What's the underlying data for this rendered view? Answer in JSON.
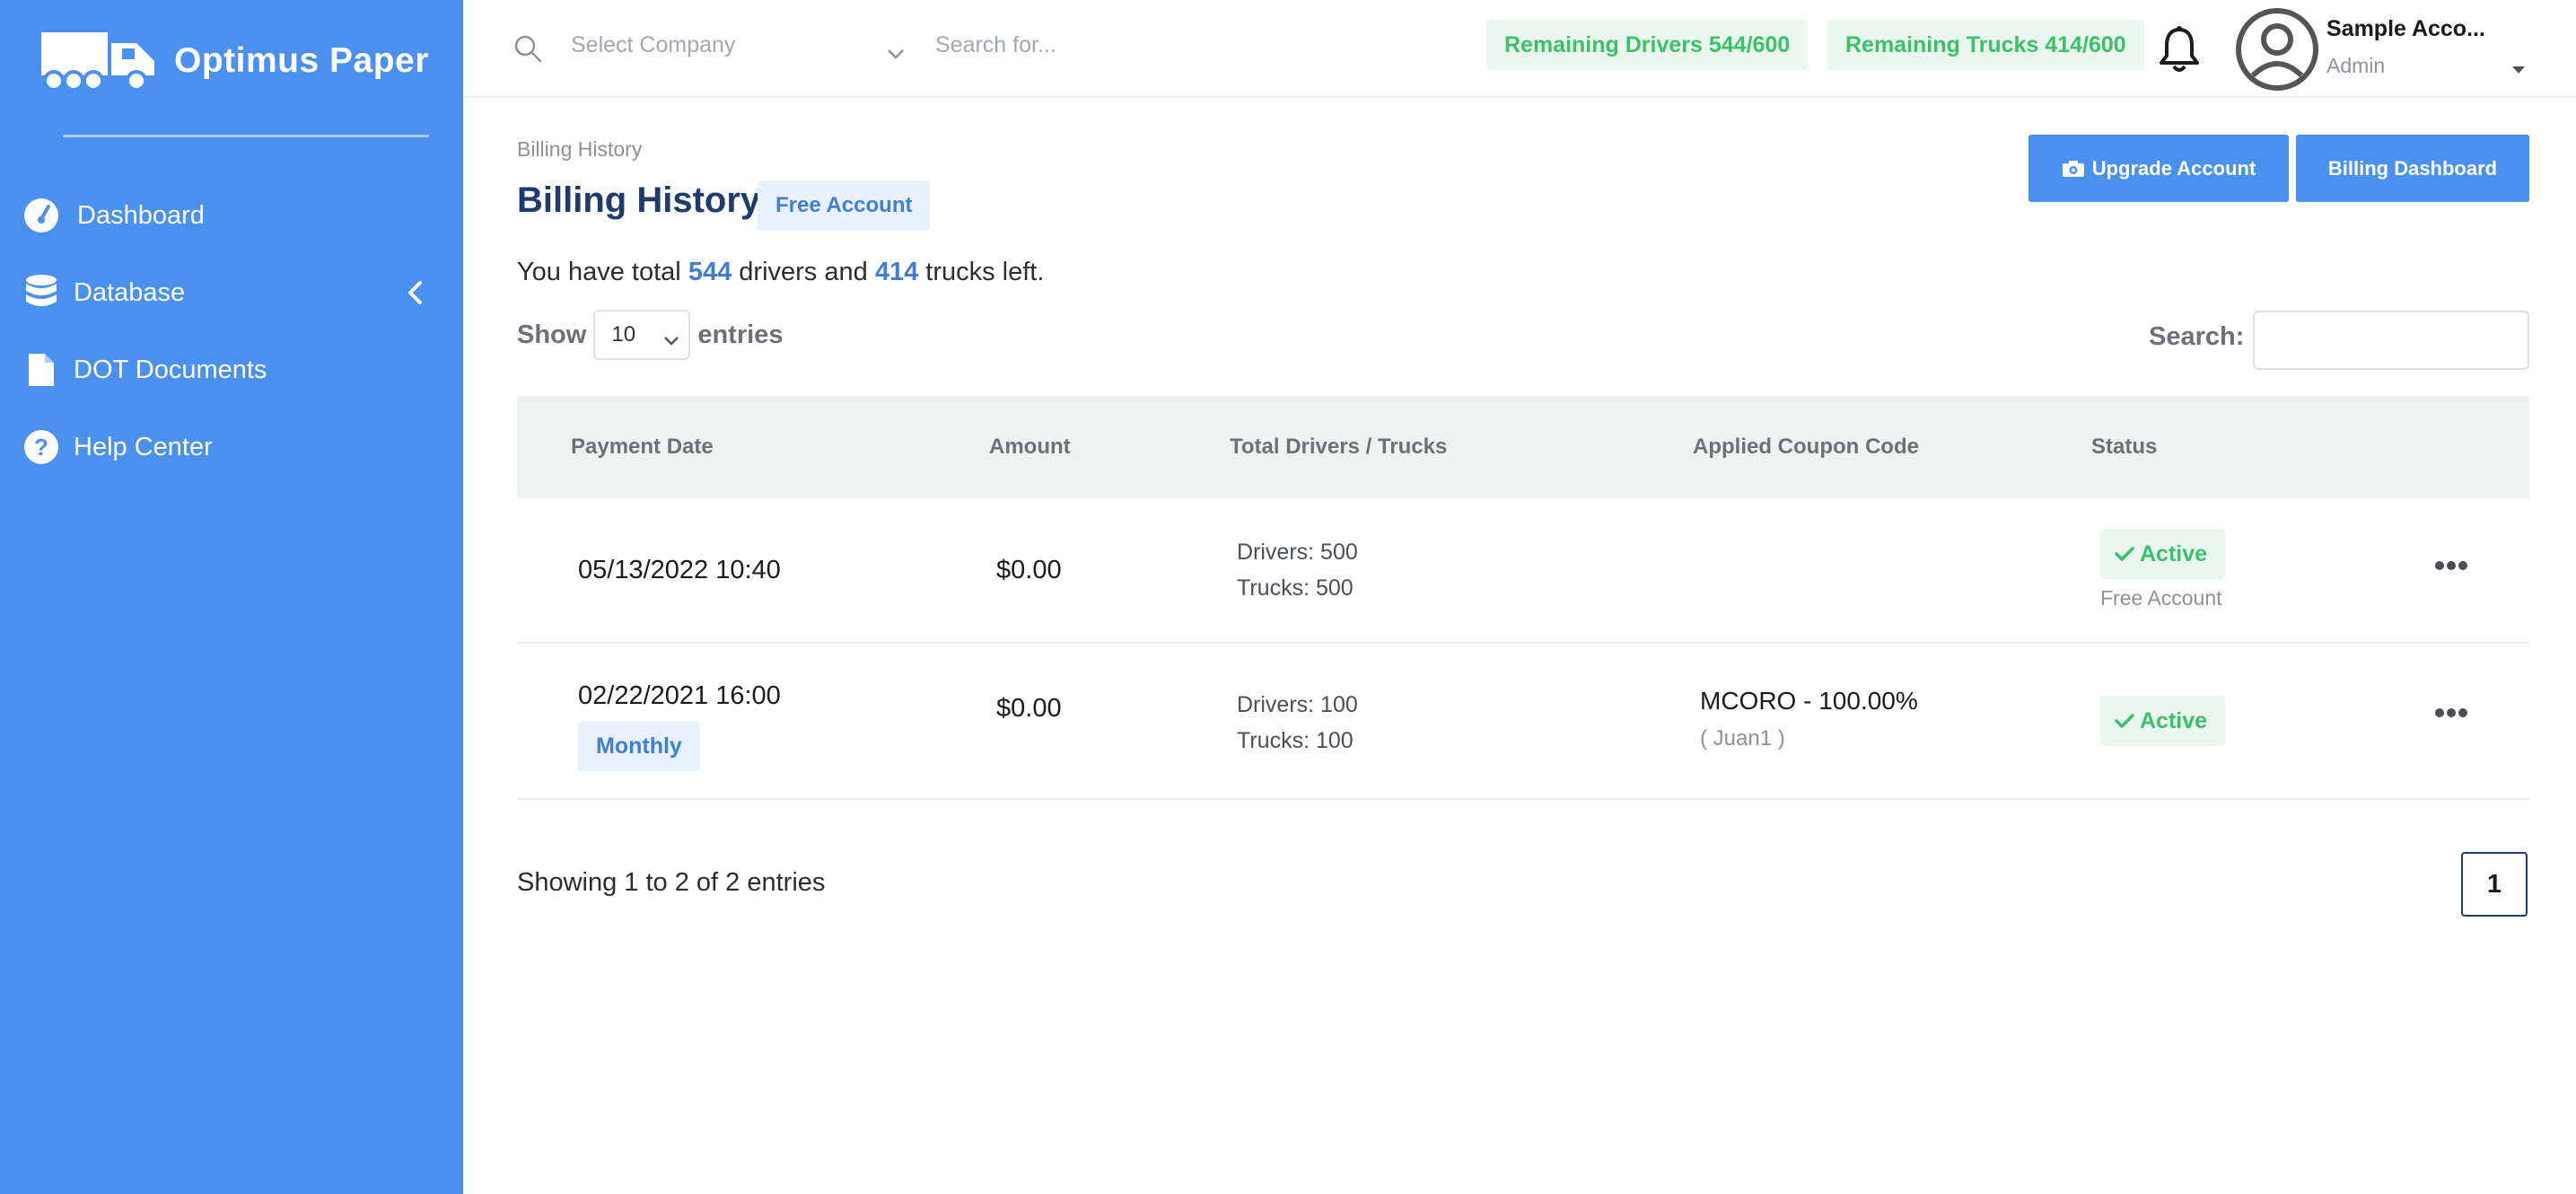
{
  "brand": {
    "name": "Optimus Paper",
    "registered_mark": "."
  },
  "sidebar": {
    "items": [
      {
        "label": "Dashboard",
        "icon": "dashboard-gauge-icon"
      },
      {
        "label": "Database",
        "icon": "database-icon"
      },
      {
        "label": "DOT Documents",
        "icon": "document-icon"
      },
      {
        "label": "Help Center",
        "icon": "question-circle-icon"
      }
    ]
  },
  "topbar": {
    "company_placeholder": "Select Company",
    "search_placeholder": "Search for...",
    "remaining_drivers": "Remaining Drivers 544/600",
    "remaining_trucks": "Remaining Trucks 414/600",
    "user_name": "Sample Acco...",
    "user_role": "Admin"
  },
  "page": {
    "breadcrumb": "Billing History",
    "title": "Billing History",
    "account_badge": "Free Account",
    "upgrade_button": "Upgrade Account",
    "billing_dashboard_button": "Billing Dashboard",
    "summary_prefix": "You have total",
    "summary_drivers": "544",
    "summary_middle": "drivers and",
    "summary_trucks": "414",
    "summary_suffix": "trucks left.",
    "show_label": "Show",
    "entries_value": "10",
    "entries_label": "entries",
    "search_label": "Search:"
  },
  "table": {
    "headers": [
      "Payment Date",
      "Amount",
      "Total Drivers / Trucks",
      "Applied Coupon Code",
      "Status"
    ],
    "rows": [
      {
        "date": "05/13/2022 10:40",
        "plan": "",
        "amount": "$0.00",
        "drivers": "Drivers: 500",
        "trucks": "Trucks: 500",
        "coupon": "",
        "coupon_user": "",
        "status": "Active",
        "status_sub": "Free Account"
      },
      {
        "date": "02/22/2021 16:00",
        "plan": "Monthly",
        "amount": "$0.00",
        "drivers": "Drivers: 100",
        "trucks": "Trucks: 100",
        "coupon": "MCORO - 100.00%",
        "coupon_user": "( Juan1 )",
        "status": "Active",
        "status_sub": ""
      }
    ]
  },
  "footer": {
    "showing": "Showing 1 to 2 of 2 entries",
    "page": "1"
  },
  "colors": {
    "sidebar": "#4a90ee",
    "primary": "#4a90ee",
    "title": "#1e3a6e",
    "success": "#3cc06a",
    "success_bg": "#eaf7ee",
    "info_bg": "#e8f1fd"
  }
}
